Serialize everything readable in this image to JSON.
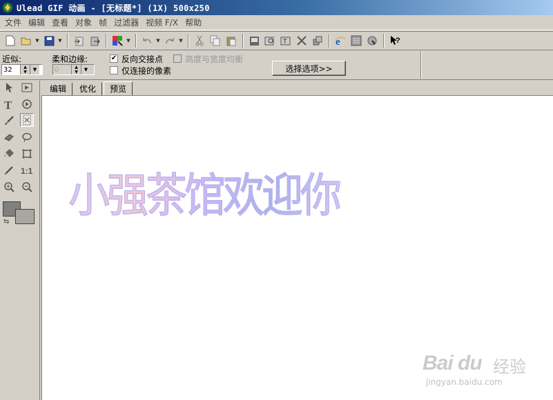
{
  "window": {
    "title": "Ulead GIF 动画 - [无标题*] (1X) 500x250"
  },
  "menu": [
    {
      "label": "文件"
    },
    {
      "label": "编辑"
    },
    {
      "label": "查看"
    },
    {
      "label": "对象"
    },
    {
      "label": "帧"
    },
    {
      "label": "过滤器"
    },
    {
      "label": "视频 F/X"
    },
    {
      "label": "帮助"
    }
  ],
  "toolbar": {
    "icons": [
      "new-file-icon",
      "open-folder-icon",
      "save-icon",
      "import-icon",
      "export-icon",
      "color-palette-icon",
      "undo-icon",
      "redo-icon",
      "cut-icon",
      "copy-icon",
      "paste-icon",
      "add-frame-icon",
      "add-image-icon",
      "add-text-icon",
      "crop-icon",
      "tween-icon",
      "browser-preview-icon",
      "banner-icon",
      "optimize-icon",
      "help-icon"
    ]
  },
  "options": {
    "similarity_label": "近似:",
    "similarity_value": "32",
    "soft_edge_label": "柔和边缘:",
    "soft_edge_value": "0",
    "invert_label": "反向交接点",
    "invert_checked": "✔",
    "equal_label": "高度与宽度均衡",
    "connected_label": "仅连接的像素",
    "select_options_button": "选择选项>>"
  },
  "tabs": [
    {
      "label": "编辑"
    },
    {
      "label": "优化"
    },
    {
      "label": "预览"
    }
  ],
  "canvas": {
    "text": "小强茶馆欢迎你"
  },
  "watermark": {
    "logo": "Bai du",
    "cn": "经验",
    "url": "jingyan.baidu.com"
  },
  "colors": {
    "title_start": "#0a246a",
    "title_end": "#a6caf0",
    "chrome": "#d4d0c8",
    "canvas_text": "#b9b2ec"
  }
}
